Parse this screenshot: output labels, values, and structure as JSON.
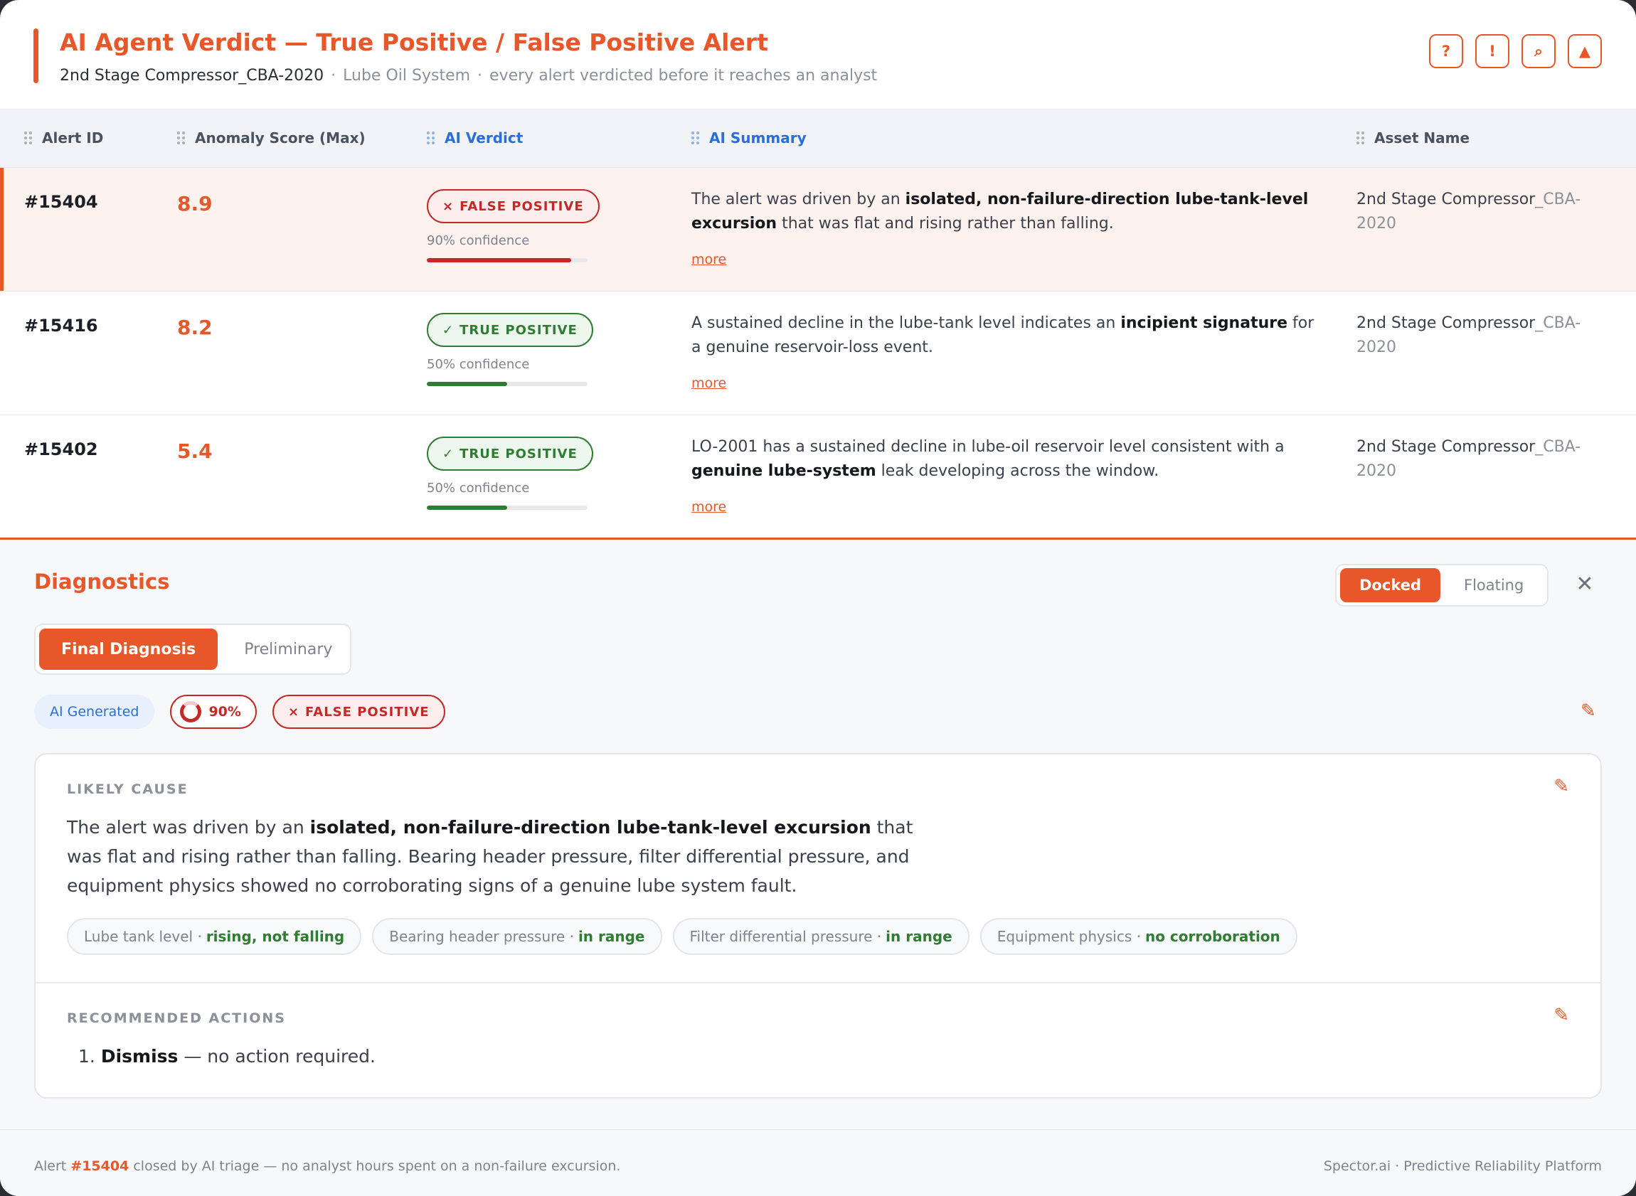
{
  "header": {
    "title": "AI Agent Verdict — True Positive / False Positive Alert",
    "asset": "2nd Stage Compressor_CBA-2020",
    "system": "Lube Oil System",
    "tagline": "every alert verdicted before it reaches an analyst",
    "separator": "·",
    "icons": [
      {
        "name": "help-icon",
        "glyph": "?"
      },
      {
        "name": "alert-icon",
        "glyph": "!"
      },
      {
        "name": "search-icon",
        "glyph": "⌕"
      },
      {
        "name": "warning-icon",
        "glyph": "▲"
      }
    ]
  },
  "table": {
    "columns": [
      "Alert ID",
      "Anomaly Score (Max)",
      "AI Verdict",
      "AI Summary",
      "Asset Name"
    ],
    "rows": [
      {
        "id": "#15404",
        "score": "8.9",
        "verdict_icon": "×",
        "verdict": "FALSE POSITIVE",
        "confidence_text": "90% confidence",
        "confidence": 0.9,
        "summary_pre": "The alert was driven by an ",
        "summary_bold": "isolated, non-failure-direction lube-tank-level excursion",
        "summary_post": " that was flat and rising rather than falling.",
        "more": "more",
        "asset_main": "2nd Stage Compressor",
        "asset_suffix": "_CBA-2020"
      },
      {
        "id": "#15416",
        "score": "8.2",
        "verdict_icon": "✓",
        "verdict": "TRUE POSITIVE",
        "confidence_text": "50% confidence",
        "confidence": 0.5,
        "summary_pre": "A sustained decline in the lube-tank level indicates an ",
        "summary_bold": "incipient signature",
        "summary_post": " for a genuine reservoir-loss event.",
        "more": "more",
        "asset_main": "2nd Stage Compressor",
        "asset_suffix": "_CBA-2020"
      },
      {
        "id": "#15402",
        "score": "5.4",
        "verdict_icon": "✓",
        "verdict": "TRUE POSITIVE",
        "confidence_text": "50% confidence",
        "confidence": 0.5,
        "summary_pre": "LO-2001 has a sustained decline in lube-oil reservoir level consistent with a ",
        "summary_bold": "genuine lube-system",
        "summary_post": " leak developing across the window.",
        "more": "more",
        "asset_main": "2nd Stage Compressor",
        "asset_suffix": "_CBA-2020"
      }
    ]
  },
  "diagnostics": {
    "title": "Diagnostics",
    "dock_options": [
      "Docked",
      "Floating"
    ],
    "dock_selected": "Docked",
    "close_glyph": "✕",
    "tabs": [
      "Final Diagnosis",
      "Preliminary"
    ],
    "tab_selected": "Final Diagnosis",
    "badge_ai": "AI Generated",
    "badge_pct": "90%",
    "badge_verdict_icon": "×",
    "badge_verdict": "FALSE POSITIVE",
    "likely_cause": {
      "label": "LIKELY CAUSE",
      "text_pre": "The alert was driven by an ",
      "text_bold": "isolated, non-failure-direction lube-tank-level excursion",
      "text_post": " that was flat and rising rather than falling. Bearing header pressure, filter differential pressure, and equipment physics showed no corroborating signs of a genuine lube system fault.",
      "chips": [
        {
          "label": "Lube tank level ·",
          "value": "rising, not falling"
        },
        {
          "label": "Bearing header pressure ·",
          "value": "in range"
        },
        {
          "label": "Filter differential pressure ·",
          "value": "in range"
        },
        {
          "label": "Equipment physics ·",
          "value": "no corroboration"
        }
      ]
    },
    "recommended": {
      "label": "RECOMMENDED ACTIONS",
      "number": "1.",
      "action_bold": "Dismiss",
      "action_rest": " — no action required."
    }
  },
  "footer": {
    "pre": "Alert ",
    "alert": "#15404",
    "post": " closed by AI triage — no analyst hours spent on a non-failure excursion.",
    "brand": "Spector.ai · Predictive Reliability Platform"
  },
  "colors": {
    "accent": "#e8572a",
    "false_positive": "#c62828",
    "true_positive": "#2e7d32",
    "link_blue": "#2a6fd6"
  }
}
